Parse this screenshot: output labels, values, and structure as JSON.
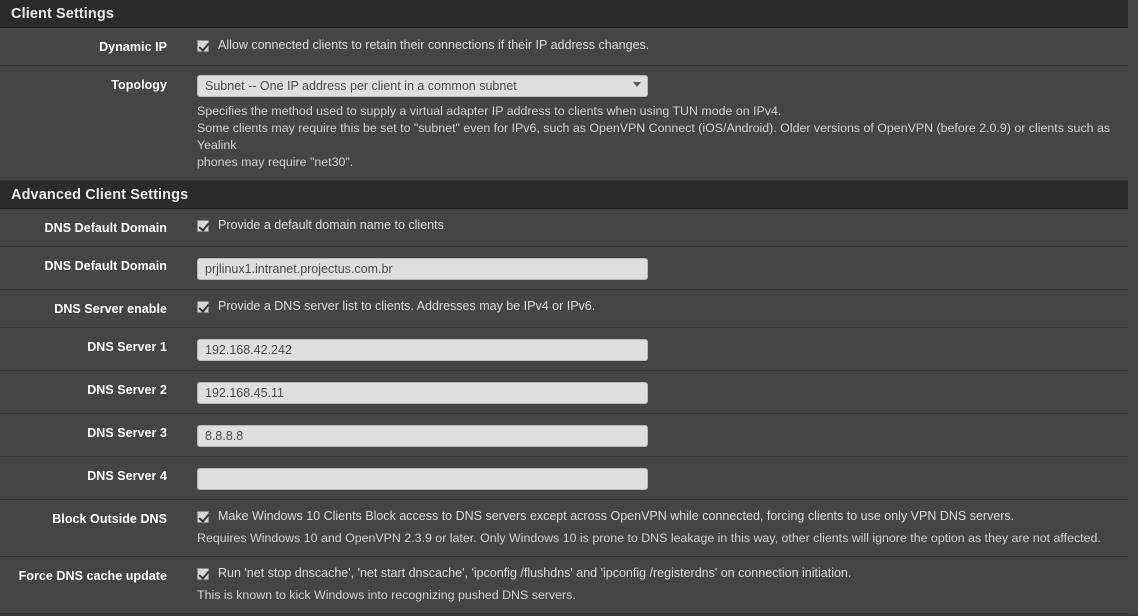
{
  "sections": [
    {
      "title": "Client Settings",
      "rows": [
        {
          "label": "Dynamic IP",
          "type": "checkbox",
          "checked": true,
          "text": "Allow connected clients to retain their connections if their IP address changes."
        },
        {
          "label": "Topology",
          "type": "select",
          "value": "Subnet -- One IP address per client in a common subnet",
          "help": [
            "Specifies the method used to supply a virtual adapter IP address to clients when using TUN mode on IPv4.",
            "Some clients may require this be set to \"subnet\" even for IPv6, such as OpenVPN Connect (iOS/Android). Older versions of OpenVPN (before 2.0.9) or clients such as Yealink",
            "phones may require \"net30\"."
          ]
        }
      ]
    },
    {
      "title": "Advanced Client Settings",
      "rows": [
        {
          "label": "DNS Default Domain",
          "type": "checkbox",
          "checked": true,
          "text": "Provide a default domain name to clients"
        },
        {
          "label": "DNS Default Domain",
          "type": "text",
          "value": "prjlinux1.intranet.projectus.com.br",
          "placeholder": ""
        },
        {
          "label": "DNS Server enable",
          "type": "checkbox",
          "checked": true,
          "text": "Provide a DNS server list to clients. Addresses may be IPv4 or IPv6."
        },
        {
          "label": "DNS Server 1",
          "type": "text",
          "value": "192.168.42.242",
          "placeholder": ""
        },
        {
          "label": "DNS Server 2",
          "type": "text",
          "value": "192.168.45.11",
          "placeholder": ""
        },
        {
          "label": "DNS Server 3",
          "type": "text",
          "value": "8.8.8.8",
          "placeholder": ""
        },
        {
          "label": "DNS Server 4",
          "type": "text",
          "value": "",
          "placeholder": ""
        },
        {
          "label": "Block Outside DNS",
          "type": "checkbox",
          "checked": true,
          "text": "Make Windows 10 Clients Block access to DNS servers except across OpenVPN while connected, forcing clients to use only VPN DNS servers.",
          "help": [
            "Requires Windows 10 and OpenVPN 2.3.9 or later. Only Windows 10 is prone to DNS leakage in this way, other clients will ignore the option as they are not affected."
          ]
        },
        {
          "label": "Force DNS cache update",
          "type": "checkbox",
          "checked": true,
          "text": "Run 'net stop dnscache', 'net start dnscache', 'ipconfig /flushdns' and 'ipconfig /registerdns' on connection initiation.",
          "help": [
            "This is known to kick Windows into recognizing pushed DNS servers."
          ]
        }
      ]
    }
  ],
  "colors": {
    "panel_bg": "#454545",
    "header_bg": "#2b2b2b",
    "input_bg": "#dedede",
    "label_text": "#ffffff",
    "body_text": "#dddddd",
    "separator": "#343434"
  }
}
